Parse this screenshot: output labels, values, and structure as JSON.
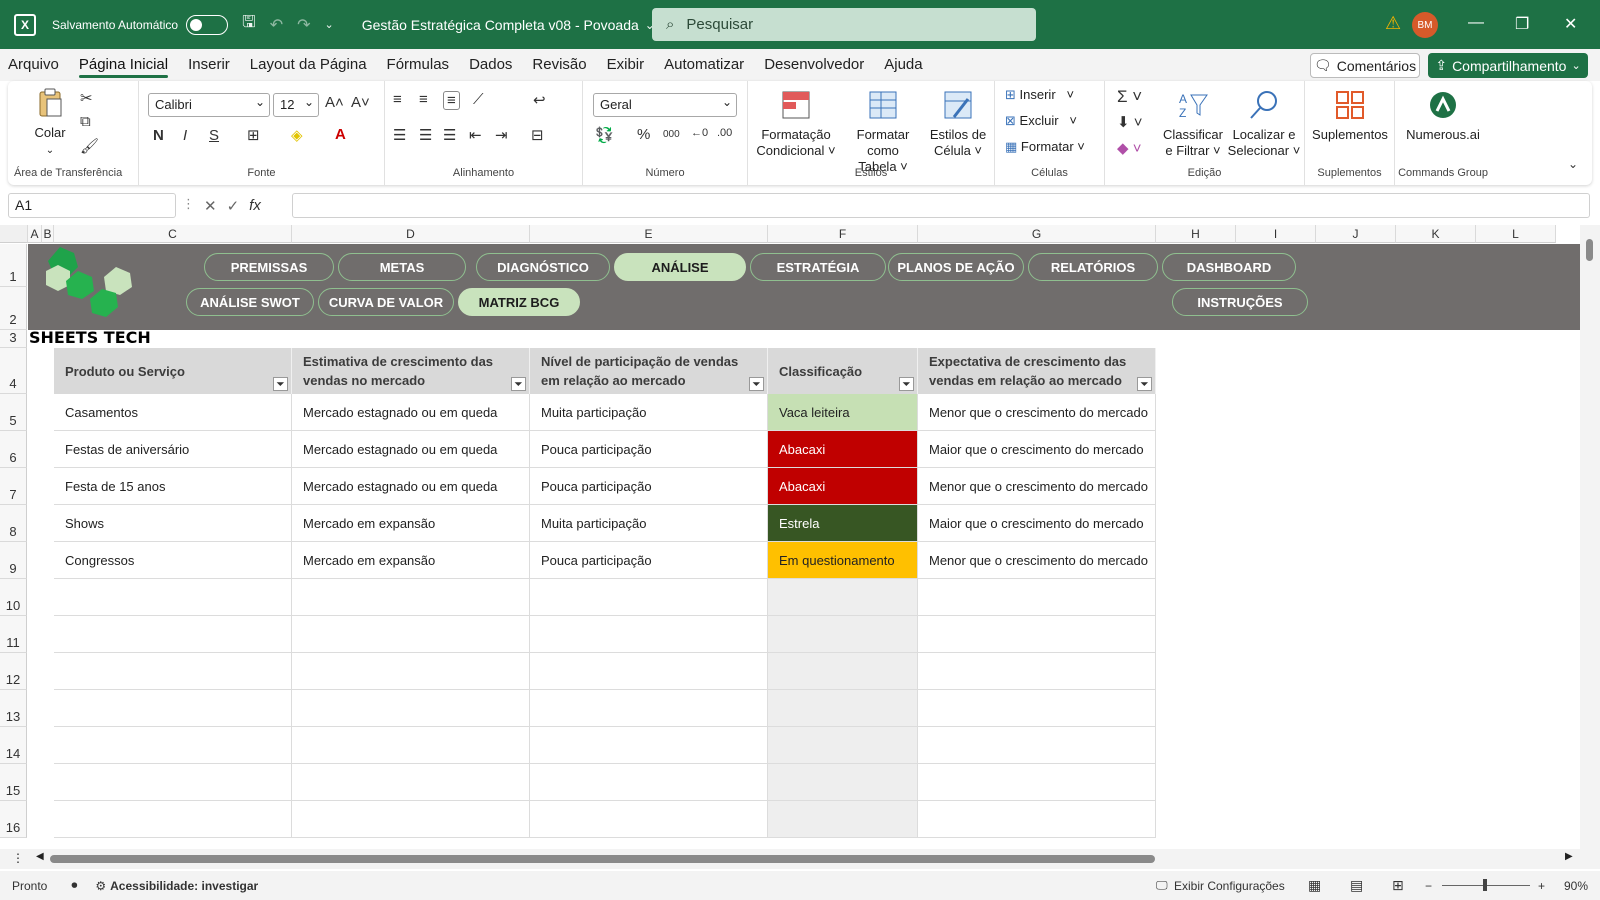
{
  "titlebar": {
    "autosave_label": "Salvamento Automático",
    "doc_title": "Gestão Estratégica Completa v08 - Povoada",
    "search_placeholder": "Pesquisar",
    "user_initials": "BM"
  },
  "menu": {
    "items": [
      "Arquivo",
      "Página Inicial",
      "Inserir",
      "Layout da Página",
      "Fórmulas",
      "Dados",
      "Revisão",
      "Exibir",
      "Automatizar",
      "Desenvolvedor",
      "Ajuda"
    ],
    "active_index": 1,
    "comments_label": "Comentários",
    "share_label": "Compartilhamento"
  },
  "ribbon": {
    "clipboard": {
      "paste_label": "Colar",
      "group_label": "Área de Transferência"
    },
    "font": {
      "font_name": "Calibri",
      "font_size": "12",
      "bold": "N",
      "italic": "I",
      "underline": "S",
      "group_label": "Fonte"
    },
    "alignment": {
      "group_label": "Alinhamento"
    },
    "number": {
      "format": "Geral",
      "percent": "%",
      "thousands": "000",
      "group_label": "Número"
    },
    "styles": {
      "conditional_line1": "Formatação",
      "conditional_line2": "Condicional",
      "table_line1": "Formatar como",
      "table_line2": "Tabela",
      "cell_line1": "Estilos de",
      "cell_line2": "Célula",
      "group_label": "Estilos"
    },
    "cells": {
      "insert": "Inserir",
      "delete": "Excluir",
      "format": "Formatar",
      "group_label": "Células"
    },
    "editing": {
      "sort_line1": "Classificar",
      "sort_line2": "e Filtrar",
      "find_line1": "Localizar e",
      "find_line2": "Selecionar",
      "group_label": "Edição"
    },
    "addins": {
      "button": "Suplementos",
      "group_label": "Suplementos"
    },
    "commands": {
      "button": "Numerous.ai",
      "group_label": "Commands Group"
    }
  },
  "formula_bar": {
    "name_box": "A1",
    "fx": "fx",
    "formula": ""
  },
  "columns": [
    "A",
    "B",
    "C",
    "D",
    "E",
    "F",
    "G",
    "H",
    "I",
    "J",
    "K",
    "L"
  ],
  "rows": [
    "1",
    "2",
    "3",
    "4",
    "5",
    "6",
    "7",
    "8",
    "9",
    "10",
    "11",
    "12",
    "13",
    "14",
    "15",
    "16"
  ],
  "banner": {
    "logo_text": "SHEETS TECH",
    "nav_row1": [
      "PREMISSAS",
      "METAS",
      "DIAGNÓSTICO",
      "ANÁLISE",
      "ESTRATÉGIA",
      "PLANOS DE AÇÃO",
      "RELATÓRIOS",
      "DASHBOARD"
    ],
    "nav_row1_active": 3,
    "nav_row2": [
      "ANÁLISE SWOT",
      "CURVA DE VALOR",
      "MATRIZ BCG"
    ],
    "nav_row2_active": 2,
    "instructions": "INSTRUÇÕES"
  },
  "table": {
    "headers": [
      "Produto ou Serviço",
      "Estimativa de crescimento das vendas no mercado",
      "Nível de participação de vendas em relação ao mercado",
      "Classificação",
      "Expectativa de crescimento das vendas em relação ao mercado"
    ],
    "rows": [
      [
        "Casamentos",
        "Mercado estagnado ou em queda",
        "Muita participação",
        "Vaca leiteira",
        "Menor que o crescimento do mercado"
      ],
      [
        "Festas de aniversário",
        "Mercado estagnado ou em queda",
        "Pouca participação",
        "Abacaxi",
        "Maior que o crescimento do mercado"
      ],
      [
        "Festa de 15 anos",
        "Mercado estagnado ou em queda",
        "Pouca participação",
        "Abacaxi",
        "Menor que o crescimento do mercado"
      ],
      [
        "Shows",
        "Mercado em expansão",
        "Muita participação",
        "Estrela",
        "Maior que o crescimento do mercado"
      ],
      [
        "Congressos",
        "Mercado em expansão",
        "Pouca participação",
        "Em questionamento",
        "Menor que o crescimento do mercado"
      ]
    ],
    "classification_colors": {
      "Vaca leiteira": "#c6e0b4",
      "Abacaxi": "#c00000",
      "Estrela": "#375623",
      "Em questionamento": "#ffc000"
    },
    "empty_rows": 7
  },
  "status": {
    "ready": "Pronto",
    "accessibility": "Acessibilidade: investigar",
    "display_settings": "Exibir Configurações",
    "zoom": "90%"
  },
  "colors": {
    "brand": "#1e7145",
    "banner": "#706d6c",
    "nav_active": "#c9e3bd"
  },
  "icons": [
    "excel-icon",
    "save-icon",
    "undo-icon",
    "redo-icon",
    "search-icon",
    "warning-icon",
    "paste-icon",
    "cut-icon",
    "copy-icon",
    "format-painter-icon",
    "sum-icon",
    "sort-filter-icon",
    "find-icon",
    "addins-icon",
    "numerous-icon"
  ]
}
